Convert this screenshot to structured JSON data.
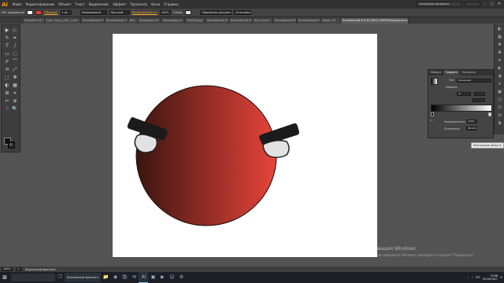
{
  "app": {
    "logo": "Ai",
    "workspace": "Основные сведения"
  },
  "menu": [
    "Файл",
    "Редактирование",
    "Объект",
    "Текст",
    "Выделение",
    "Эффект",
    "Просмотр",
    "Окно",
    "Справка"
  ],
  "controlbar": {
    "selection": "Нет выделения",
    "stroke_label": "Обводка:",
    "stroke_weight": "1 pt",
    "profile": "Равномерный",
    "brush": "Круглый",
    "opacity_label": "Непрозрачность:",
    "opacity": "100%",
    "style_label": "Стиль:",
    "docsetup": "Параметры документа",
    "prefs": "Установки"
  },
  "tabs": [
    "Мелкий.ai @ 7...",
    "Прот_Чаш_в_Мо_1.png*",
    "Безымянный-5*",
    "Безымянный-7*",
    "Без...",
    "Календарь.ai*",
    "Картридер.ai*",
    "100000.jpg*",
    "Безымянный-4*",
    "Безымянный-6*",
    "Для сод.ai*",
    "Безымянный-8*",
    "Безымянный-6*",
    "Ффорт.ai*",
    "Безымянный-8.ai @ 100% (CMYK/Предпросмотр GPU)"
  ],
  "active_tab_index": 14,
  "tools": [
    "▶",
    "▷",
    "✎",
    "✒",
    "T",
    "/",
    "▭",
    "◌",
    "✐",
    "⌒",
    "⟲",
    "⤢",
    "⬚",
    "✥",
    "◐",
    "▦",
    "⊞",
    "⌗",
    "✂",
    "⊕",
    "☝",
    "🔍"
  ],
  "gradient_panel": {
    "tabs": [
      "Обводка",
      "Градиент",
      "Прозрачно"
    ],
    "type_label": "Тип:",
    "type_value": "Линейный",
    "stroke_label": "Обводка:",
    "angle_value": "0°",
    "opacity_label": "Непрозрачность:",
    "opacity_value": "100%",
    "location_label": "Положение:",
    "location_value": "96,12%"
  },
  "tooltip": "Монтажные области",
  "status": {
    "zoom": "100%",
    "artboard": "1",
    "mode": "Выделенный фрагмент"
  },
  "watermark": {
    "line1": "Активация Windows",
    "line2": "Чтобы активировать Windows, перейдите в раздел \"Параметры\"."
  },
  "taskbar": {
    "active_app_label": "Безымянный фрагмент",
    "time": "19:56",
    "date": "05.06.2017",
    "lang": "РУС"
  },
  "colors": {
    "face_left": "#3a1510",
    "face_right": "#e8443a",
    "eyebrow": "#1b1b1b",
    "eye_white": "#e0e0e0",
    "accent": "#f5a623"
  }
}
